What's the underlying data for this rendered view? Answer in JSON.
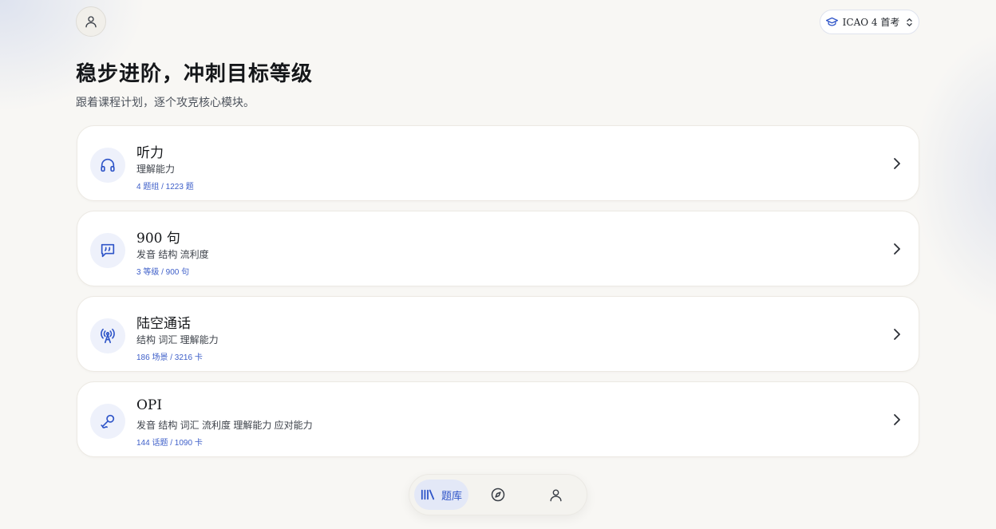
{
  "header": {
    "avatar_icon": "user-icon",
    "exam_selector": {
      "label": "ICAO 4 首考",
      "icon": "graduation-cap-icon",
      "chevron": "up-down-chevron-icon"
    }
  },
  "hero": {
    "title": "稳步进阶，冲刺目标等级",
    "subtitle": "跟着课程计划，逐个攻克核心模块。"
  },
  "modules": [
    {
      "icon": "headphones-icon",
      "name": "听力",
      "skills": "理解能力",
      "stats": "4 题组 / 1223 题"
    },
    {
      "icon": "quote-message-icon",
      "name": "900 句",
      "skills": "发音 结构 流利度",
      "stats": "3 等级 / 900 句"
    },
    {
      "icon": "radio-tower-icon",
      "name": "陆空通话",
      "skills": "结构 词汇 理解能力",
      "stats": "186 场景 / 3216 卡"
    },
    {
      "icon": "microphone-icon",
      "name": "OPI",
      "skills": "发音 结构 词汇 流利度 理解能力 应对能力",
      "stats": "144 话题 / 1090 卡"
    }
  ],
  "bottom_nav": {
    "items": [
      {
        "label": "题库",
        "icon": "library-icon",
        "active": true
      },
      {
        "label": "",
        "icon": "compass-icon",
        "active": false
      },
      {
        "label": "",
        "icon": "user-icon",
        "active": false
      }
    ]
  },
  "colors": {
    "accent": "#2f55c8",
    "icon_bg": "#eef1fb",
    "background": "#f8f7f4"
  }
}
